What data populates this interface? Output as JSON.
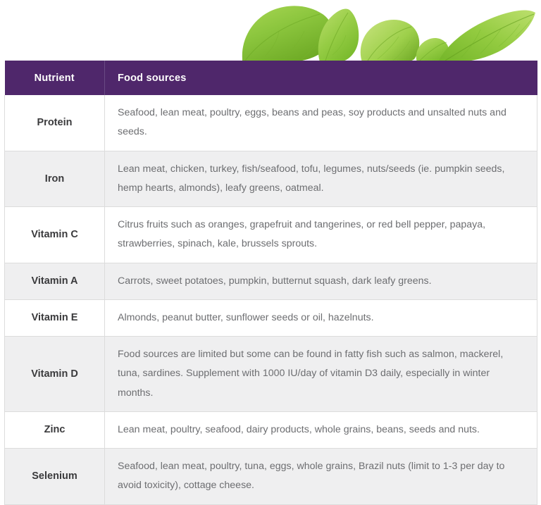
{
  "decoration": {
    "leaf_banner": {
      "icon": "green-leaves-image",
      "alt": "green leaves",
      "colors": [
        "#8cc63e",
        "#a6d44a",
        "#76b82a",
        "#b9dd6a",
        "#6aa522"
      ]
    }
  },
  "theme": {
    "header_purple": "#4f276b",
    "row_shaded": "#efeff0",
    "row_white": "#ffffff",
    "border": "#dcdcdc",
    "body_text": "#6d6e71",
    "nutrient_text": "#3a3a3c",
    "header_text": "#ffffff"
  },
  "table": {
    "columns": [
      {
        "key": "nutrient",
        "label": "Nutrient"
      },
      {
        "key": "sources",
        "label": "Food sources"
      }
    ],
    "rows": [
      {
        "nutrient": "Protein",
        "sources": "Seafood, lean meat, poultry, eggs, beans and peas, soy products and unsalted nuts and seeds."
      },
      {
        "nutrient": "Iron",
        "sources": "Lean meat, chicken, turkey, fish/seafood, tofu, legumes, nuts/seeds (ie. pumpkin seeds, hemp hearts, almonds), leafy greens, oatmeal."
      },
      {
        "nutrient": "Vitamin C",
        "sources": "Citrus fruits such as oranges, grapefruit and tangerines, or red bell pepper, papaya, strawberries, spinach, kale, brussels sprouts."
      },
      {
        "nutrient": "Vitamin A",
        "sources": "Carrots, sweet potatoes, pumpkin, butternut squash, dark leafy greens."
      },
      {
        "nutrient": "Vitamin E",
        "sources": "Almonds, peanut butter, sunflower seeds or oil, hazelnuts."
      },
      {
        "nutrient": "Vitamin D",
        "sources": "Food sources are limited but some can be found in fatty fish such as salmon, mackerel, tuna, sardines. Supplement with 1000 IU/day of vitamin D3 daily, especially in winter months."
      },
      {
        "nutrient": "Zinc",
        "sources": "Lean meat, poultry, seafood, dairy products, whole grains, beans, seeds and nuts."
      },
      {
        "nutrient": "Selenium",
        "sources": "Seafood, lean meat, poultry, tuna, eggs, whole grains, Brazil nuts (limit to 1-3 per day to avoid toxicity), cottage cheese."
      }
    ]
  }
}
